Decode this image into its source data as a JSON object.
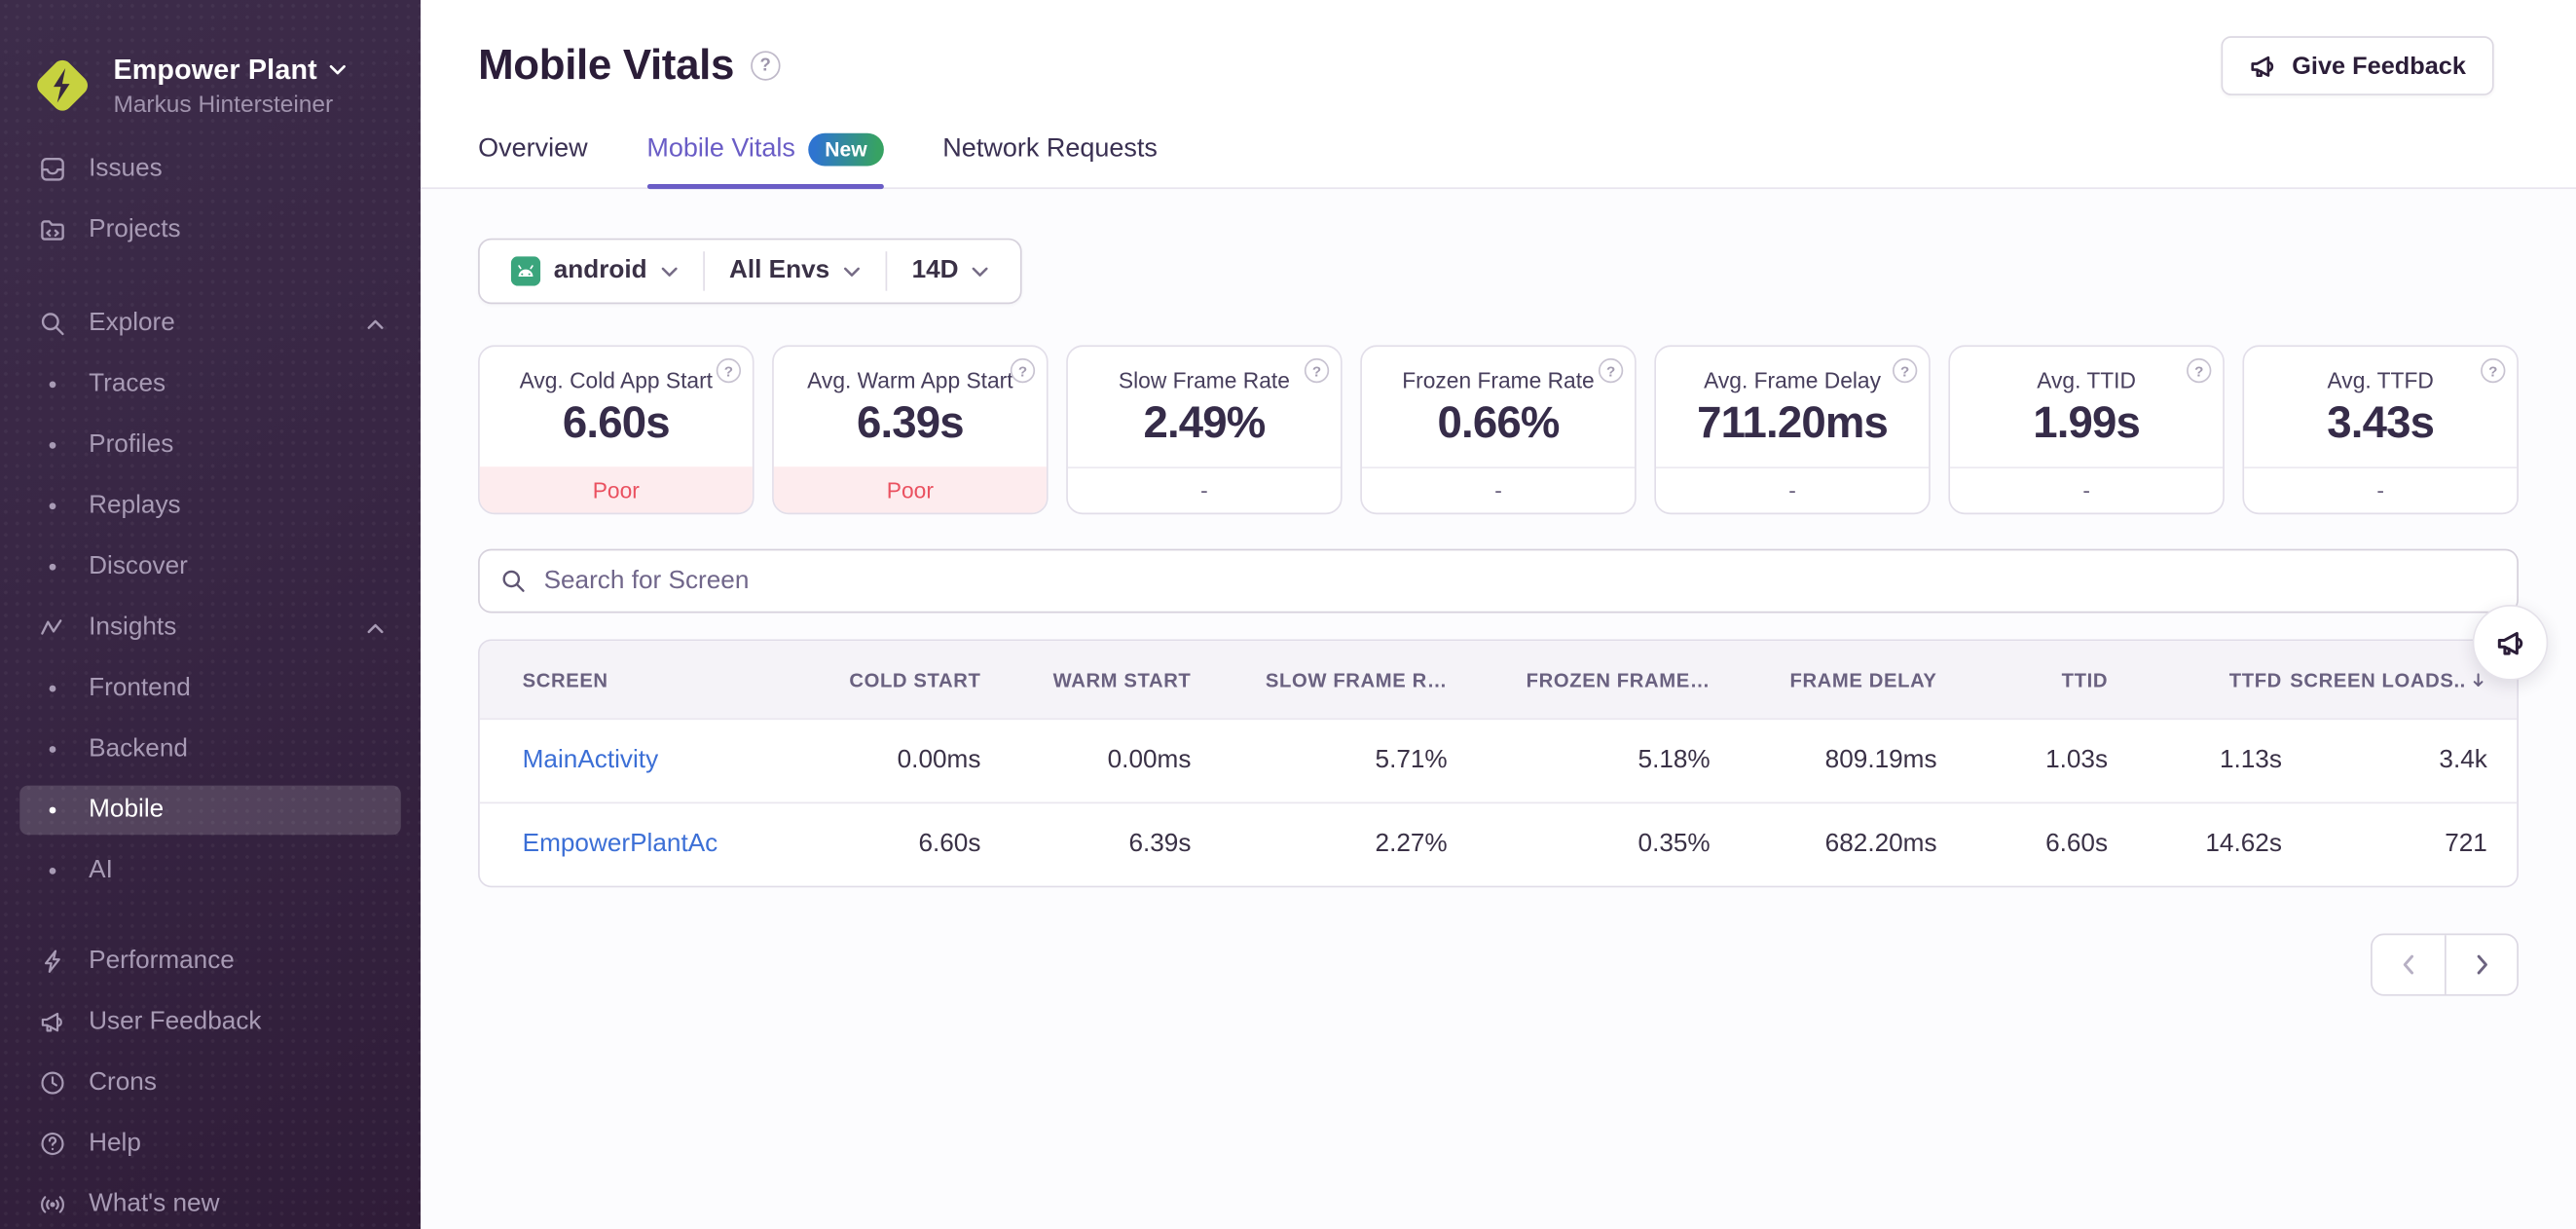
{
  "sidebar": {
    "org": {
      "name": "Empower Plant",
      "user": "Markus Hintersteiner"
    },
    "items": [
      {
        "label": "Issues"
      },
      {
        "label": "Projects"
      },
      {
        "label": "Explore",
        "collapsible": true
      },
      {
        "label": "Traces"
      },
      {
        "label": "Profiles"
      },
      {
        "label": "Replays"
      },
      {
        "label": "Discover"
      },
      {
        "label": "Insights",
        "collapsible": true
      },
      {
        "label": "Frontend"
      },
      {
        "label": "Backend"
      },
      {
        "label": "Mobile",
        "active": true
      },
      {
        "label": "AI"
      },
      {
        "label": "Performance"
      },
      {
        "label": "User Feedback"
      },
      {
        "label": "Crons"
      },
      {
        "label": "Help"
      },
      {
        "label": "What's new"
      }
    ]
  },
  "header": {
    "title": "Mobile Vitals",
    "feedback_label": "Give Feedback"
  },
  "tabs": [
    {
      "label": "Overview",
      "active": false
    },
    {
      "label": "Mobile Vitals",
      "badge": "New",
      "active": true
    },
    {
      "label": "Network Requests",
      "active": false
    }
  ],
  "filters": {
    "project": "android",
    "environment": "All Envs",
    "date_range": "14D"
  },
  "vitals_cards": [
    {
      "label": "Avg. Cold App Start",
      "value": "6.60s",
      "status": "Poor"
    },
    {
      "label": "Avg. Warm App Start",
      "value": "6.39s",
      "status": "Poor"
    },
    {
      "label": "Slow Frame Rate",
      "value": "2.49%",
      "status": "-"
    },
    {
      "label": "Frozen Frame Rate",
      "value": "0.66%",
      "status": "-"
    },
    {
      "label": "Avg. Frame Delay",
      "value": "711.20ms",
      "status": "-"
    },
    {
      "label": "Avg. TTID",
      "value": "1.99s",
      "status": "-"
    },
    {
      "label": "Avg. TTFD",
      "value": "3.43s",
      "status": "-"
    }
  ],
  "search": {
    "placeholder": "Search for Screen"
  },
  "table": {
    "columns": [
      "SCREEN",
      "COLD START",
      "WARM START",
      "SLOW FRAME R…",
      "FROZEN FRAME…",
      "FRAME DELAY",
      "TTID",
      "TTFD",
      "SCREEN LOADS.."
    ],
    "rows": [
      {
        "screen": "MainActivity",
        "cold_start": "0.00ms",
        "warm_start": "0.00ms",
        "slow_frame_rate": "5.71%",
        "frozen_frame_rate": "5.18%",
        "frame_delay": "809.19ms",
        "ttid": "1.03s",
        "ttfd": "1.13s",
        "screen_loads": "3.4k"
      },
      {
        "screen": "EmpowerPlantAc",
        "cold_start": "6.60s",
        "warm_start": "6.39s",
        "slow_frame_rate": "2.27%",
        "frozen_frame_rate": "0.35%",
        "frame_delay": "682.20ms",
        "ttid": "6.60s",
        "ttfd": "14.62s",
        "screen_loads": "721"
      }
    ]
  },
  "icons": {
    "question_mark": "?"
  },
  "colors": {
    "sidebar_bg": "#32203d",
    "accent_purple": "#6a5dc6",
    "badge_gradient_start": "#2e74d0",
    "badge_gradient_end": "#37a263",
    "poor_red": "#ea5160",
    "poor_bg": "#fdecee",
    "link_blue": "#3c6fd6",
    "android_green": "#3aa57c",
    "logo_yellow": "#c7d23f"
  }
}
